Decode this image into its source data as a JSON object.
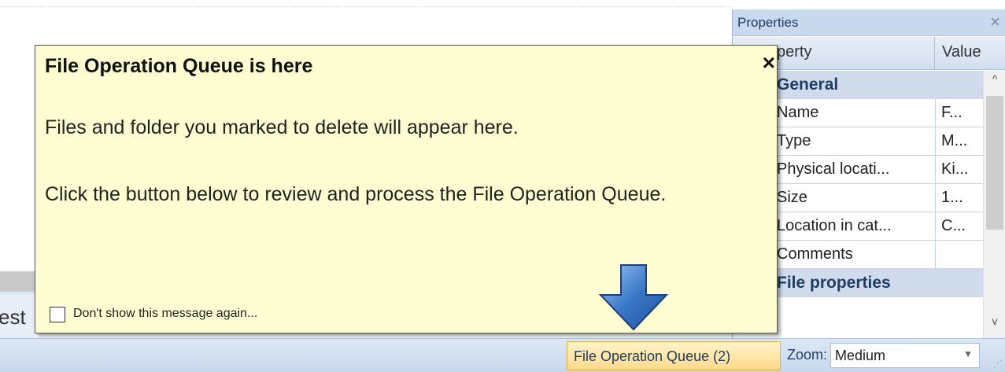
{
  "background": {
    "left_text": "est"
  },
  "properties_panel": {
    "title": "Properties",
    "close_glyph": "×",
    "columns": {
      "property": "perty",
      "value": "Value"
    },
    "categories": [
      {
        "label": "General"
      },
      {
        "label": "File properties"
      }
    ],
    "rows": [
      {
        "name": "Name",
        "value": "F..."
      },
      {
        "name": "Type",
        "value": "M..."
      },
      {
        "name": "Physical locati...",
        "value": "Ki..."
      },
      {
        "name": "Size",
        "value": "1..."
      },
      {
        "name": "Location in cat...",
        "value": "C..."
      },
      {
        "name": "Comments",
        "value": ""
      }
    ],
    "scrollbar": {
      "up_icon": "chevron-up-icon",
      "down_icon": "chevron-down-icon"
    }
  },
  "balloon": {
    "title": "File Operation Queue is here",
    "close_glyph": "×",
    "text1": "Files and folder you marked to delete will appear here.",
    "text2": "Click the button below to review and process the File Operation Queue.",
    "checkbox_label": "Don't show this message again...",
    "checkbox_checked": false,
    "arrow_icon": "arrow-down-icon",
    "arrow_color": "#3a78c8"
  },
  "status_bar": {
    "queue_button": "File Operation Queue (2)",
    "zoom_label": "Zoom:",
    "zoom_value": "Medium"
  },
  "colors": {
    "balloon_bg": "#fdfdd1",
    "panel_header": "#c9d9ee",
    "queue_button_bg": "#ffd98a"
  }
}
